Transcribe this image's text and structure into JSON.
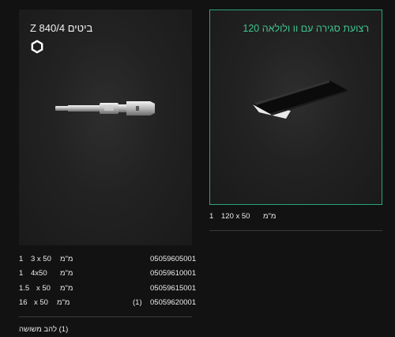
{
  "left_product": {
    "title": "ביטים Z 840/4",
    "rows": [
      {
        "qty": "1",
        "size": "3 x 50",
        "unit": "מ\"מ",
        "note": "",
        "code": "05059605001"
      },
      {
        "qty": "1",
        "size": "4x50",
        "unit": "מ\"מ",
        "note": "",
        "code": "05059610001"
      },
      {
        "qty": "1.5",
        "size": "x 50",
        "unit": "מ\"מ",
        "note": "",
        "code": "05059615001"
      },
      {
        "qty": "16",
        "size": "x 50",
        "unit": "מ\"מ",
        "note": "(1)",
        "code": "05059620001"
      }
    ],
    "footnote": "(1) להב משושה"
  },
  "right_product": {
    "title": "רצועת סגירה עם וו ולולאה 120",
    "rows": [
      {
        "qty": "1",
        "size": "120 x 50",
        "unit": "מ\"מ"
      }
    ]
  },
  "colors": {
    "background": "#121212",
    "card": "#222222",
    "accent": "#2aa57a",
    "accent_text": "#3fc48f"
  },
  "icons": {
    "hex": "hexagon-outline-icon",
    "bit": "screwdriver-bit-image",
    "pad": "hook-loop-pad-image"
  }
}
